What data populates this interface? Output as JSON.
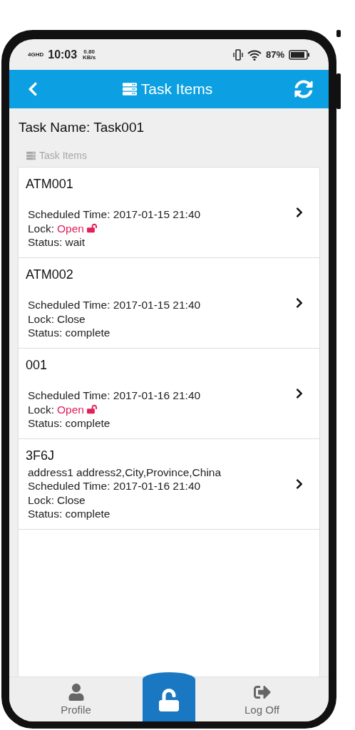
{
  "status_bar": {
    "network": "4GHD",
    "time": "10:03",
    "speed": "0.80 KB/s",
    "battery": "87%"
  },
  "header": {
    "title": "Task Items"
  },
  "task_name": "Task Name: Task001",
  "section_label": "Task Items",
  "items": [
    {
      "title": "ATM001",
      "scheduled": "Scheduled Time: 2017-01-15 21:40",
      "lock_label": "Lock:",
      "lock": "Open",
      "lock_open": true,
      "status": "Status: wait"
    },
    {
      "title": "ATM002",
      "scheduled": "Scheduled Time: 2017-01-15 21:40",
      "lock_label": "Lock:",
      "lock": "Close",
      "lock_open": false,
      "status": "Status: complete"
    },
    {
      "title": "001",
      "scheduled": "Scheduled Time: 2017-01-16 21:40",
      "lock_label": "Lock:",
      "lock": "Open",
      "lock_open": true,
      "status": "Status: complete"
    },
    {
      "title": "3F6J",
      "address": "address1 address2,City,Province,China",
      "scheduled": "Scheduled Time: 2017-01-16 21:40",
      "lock_label": "Lock:",
      "lock": "Close",
      "lock_open": false,
      "status": "Status: complete"
    }
  ],
  "nav": [
    {
      "kind": "profile",
      "label": "Profile"
    },
    {
      "kind": "unlock"
    },
    {
      "kind": "logoff",
      "label": "Log Off"
    }
  ]
}
